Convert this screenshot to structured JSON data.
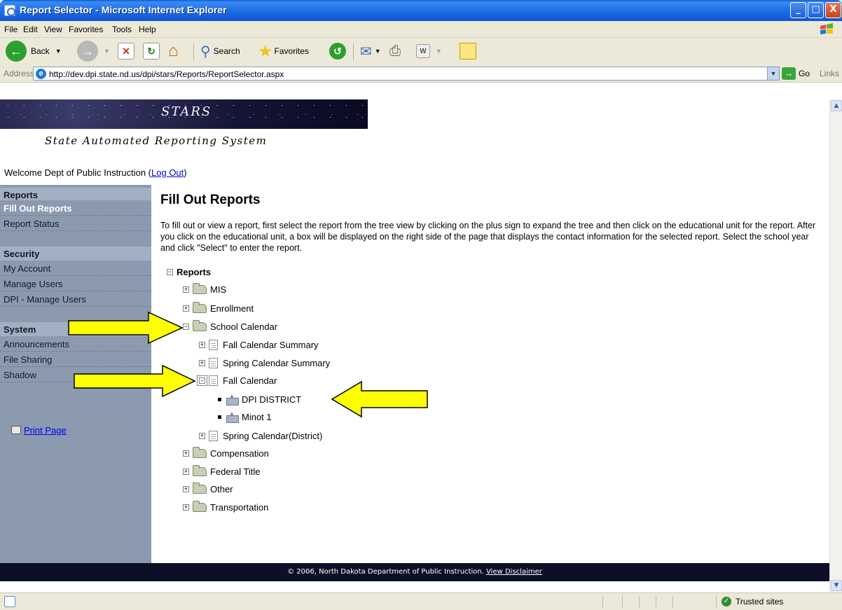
{
  "window": {
    "title": "Report Selector - Microsoft Internet Explorer",
    "min": "_",
    "max": "□",
    "close": "X"
  },
  "menu": [
    "File",
    "Edit",
    "View",
    "Favorites",
    "Tools",
    "Help"
  ],
  "toolbar": {
    "back": "Back",
    "search": "Search",
    "favorites": "Favorites"
  },
  "address": {
    "label": "Address",
    "url": "http://dev.dpi.state.nd.us/dpi/stars/Reports/ReportSelector.aspx",
    "go": "Go",
    "links": "Links"
  },
  "banner": {
    "title": "STARS",
    "subtitle": "State Automated Reporting System"
  },
  "welcome": {
    "text": "Welcome Dept of Public Instruction (",
    "logout": "Log Out",
    "close": ")"
  },
  "sidebar": {
    "reports_header": "Reports",
    "reports_items": [
      "Fill Out Reports",
      "Report Status"
    ],
    "security_header": "Security",
    "security_items": [
      "My Account",
      "Manage Users",
      "DPI - Manage Users"
    ],
    "system_header": "System",
    "system_items": [
      "Announcements",
      "File Sharing",
      "Shadow"
    ],
    "print": "Print Page"
  },
  "main": {
    "title": "Fill Out Reports",
    "intro": "To fill out or view a report, first select the report from the tree view by clicking on the plus sign to expand the tree and then click on the educational unit for the report. After you click on the educational unit, a box will be displayed on the right side of the page that displays the contact information for the selected report. Select the school year and click \"Select\" to enter the report."
  },
  "tree": {
    "root": "Reports",
    "nodes": [
      "MIS",
      "Enrollment",
      "School Calendar",
      "Fall Calendar Summary",
      "Spring Calendar Summary",
      "Fall Calendar",
      "DPI DISTRICT",
      "Minot 1",
      "Spring Calendar(District)",
      "Compensation",
      "Federal Title",
      "Other",
      "Transportation"
    ]
  },
  "footer": {
    "text": "© 2006, North Dakota Department of Public Instruction.",
    "link": "View Disclaimer"
  },
  "status": {
    "zone": "Trusted sites"
  },
  "colors": {
    "sidebar": "#8c9ab0",
    "footer": "#0d0f28",
    "arrow": "#ffff00"
  }
}
